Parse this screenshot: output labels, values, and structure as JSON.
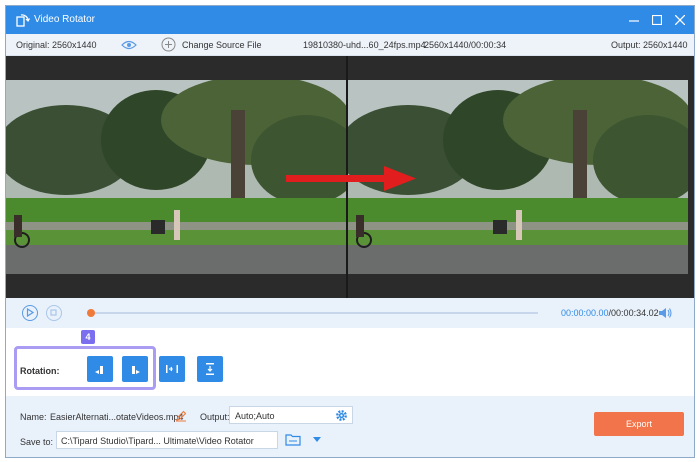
{
  "window": {
    "title": "Video Rotator",
    "accent_color": "#2f8be6"
  },
  "infobar": {
    "original": "Original: 2560x1440",
    "change_source": "Change Source File",
    "filename": "19810380-uhd...60_24fps.mp4",
    "fileinfo": "2560x1440/00:00:34",
    "output": "Output: 2560x1440"
  },
  "player": {
    "current_time": "00:00:00.00",
    "total_time": "/00:00:34.02",
    "progress_fraction": 0
  },
  "rotation": {
    "step_badge": "4",
    "label": "Rotation:",
    "buttons": [
      "rotate-left-icon",
      "rotate-right-icon",
      "flip-horizontal-icon",
      "flip-vertical-icon"
    ]
  },
  "bottom": {
    "name_label": "Name:",
    "name_value": "EasierAlternati...otateVideos.mp4",
    "output_label": "Output:",
    "output_value": "Auto;Auto",
    "saveto_label": "Save to:",
    "saveto_value": "C:\\Tipard Studio\\Tipard... Ultimate\\Video Rotator",
    "export_label": "Export",
    "export_color": "#f2744a"
  }
}
